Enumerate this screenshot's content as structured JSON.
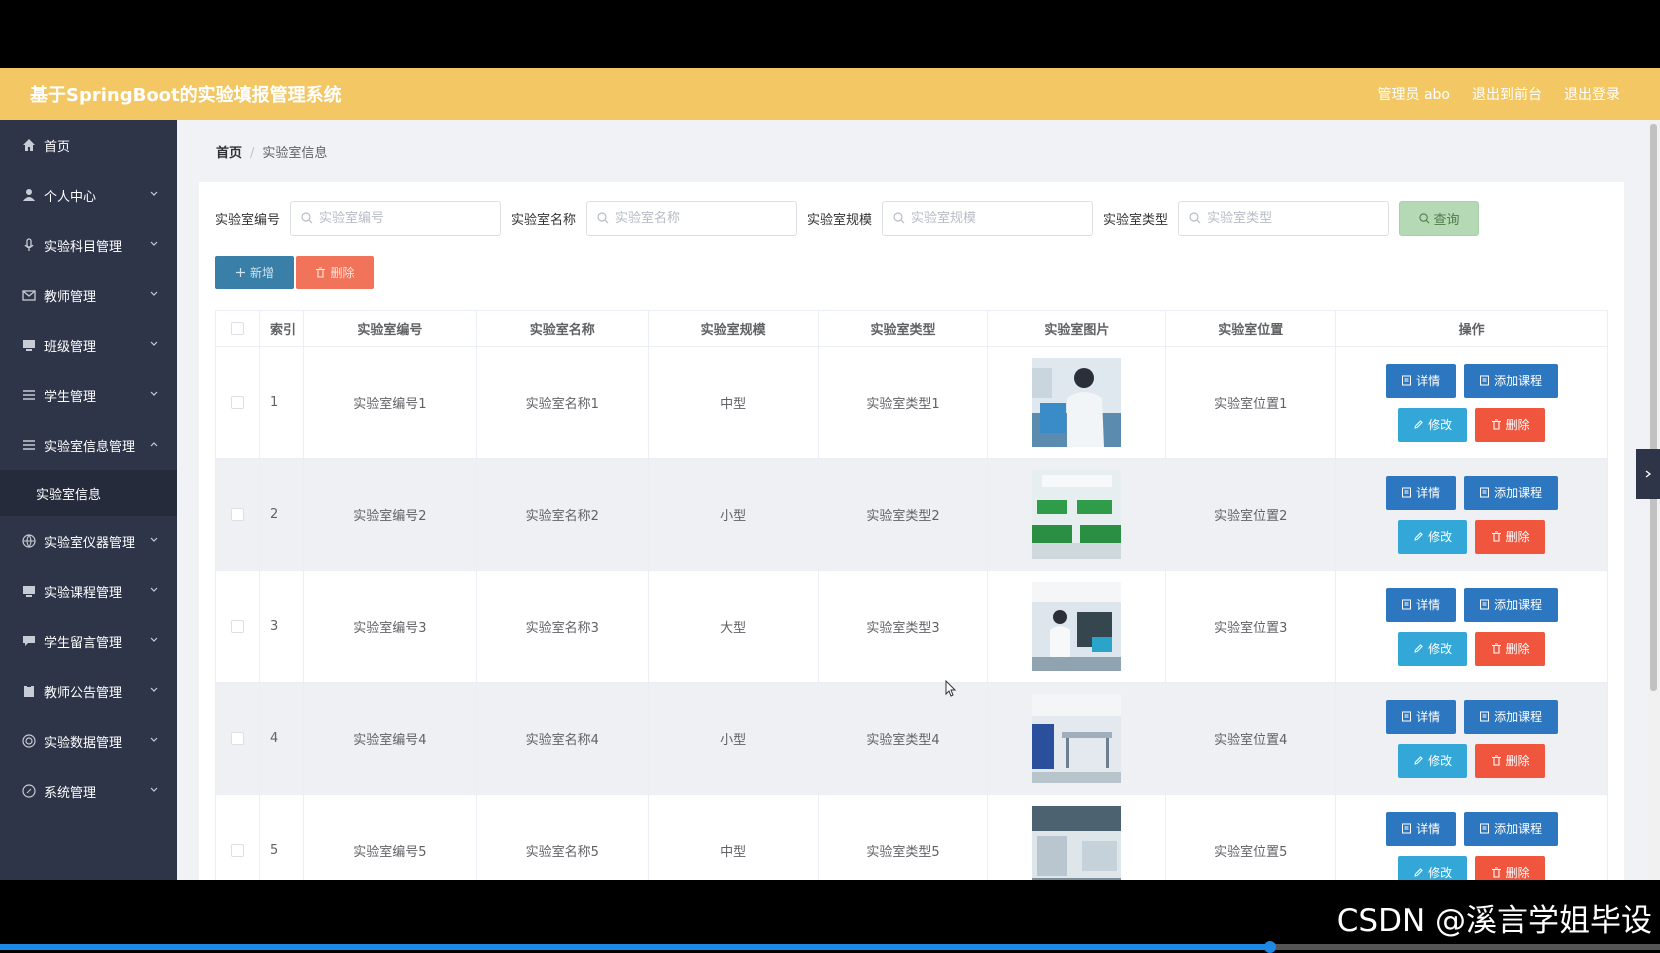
{
  "header": {
    "title": "基于SpringBoot的实验填报管理系统",
    "user": "管理员 abo",
    "to_front": "退出到前台",
    "logout": "退出登录"
  },
  "sidebar": {
    "items": [
      {
        "label": "首页",
        "icon": "home-icon"
      },
      {
        "label": "个人中心",
        "icon": "user-icon"
      },
      {
        "label": "实验科目管理",
        "icon": "mic-icon"
      },
      {
        "label": "教师管理",
        "icon": "mail-icon"
      },
      {
        "label": "班级管理",
        "icon": "monitor-icon"
      },
      {
        "label": "学生管理",
        "icon": "list-icon"
      },
      {
        "label": "实验室信息管理",
        "icon": "list-icon"
      },
      {
        "label": "实验室仪器管理",
        "icon": "globe-icon"
      },
      {
        "label": "实验课程管理",
        "icon": "monitor-icon"
      },
      {
        "label": "学生留言管理",
        "icon": "chat-icon"
      },
      {
        "label": "教师公告管理",
        "icon": "clipboard-icon"
      },
      {
        "label": "实验数据管理",
        "icon": "target-icon"
      },
      {
        "label": "系统管理",
        "icon": "compass-icon"
      }
    ],
    "sub_item": "实验室信息"
  },
  "breadcrumb": {
    "home": "首页",
    "sep": "/",
    "current": "实验室信息"
  },
  "search": {
    "fields": [
      {
        "label": "实验室编号",
        "placeholder": "实验室编号"
      },
      {
        "label": "实验室名称",
        "placeholder": "实验室名称"
      },
      {
        "label": "实验室规模",
        "placeholder": "实验室规模"
      },
      {
        "label": "实验室类型",
        "placeholder": "实验室类型"
      }
    ],
    "query_label": "查询"
  },
  "actions": {
    "add_label": "新增",
    "delete_label": "删除"
  },
  "table": {
    "columns": [
      "索引",
      "实验室编号",
      "实验室名称",
      "实验室规模",
      "实验室类型",
      "实验室图片",
      "实验室位置",
      "操作"
    ],
    "rows": [
      {
        "index": "1",
        "no": "实验室编号1",
        "name": "实验室名称1",
        "scale": "中型",
        "type": "实验室类型1",
        "location": "实验室位置1"
      },
      {
        "index": "2",
        "no": "实验室编号2",
        "name": "实验室名称2",
        "scale": "小型",
        "type": "实验室类型2",
        "location": "实验室位置2"
      },
      {
        "index": "3",
        "no": "实验室编号3",
        "name": "实验室名称3",
        "scale": "大型",
        "type": "实验室类型3",
        "location": "实验室位置3"
      },
      {
        "index": "4",
        "no": "实验室编号4",
        "name": "实验室名称4",
        "scale": "小型",
        "type": "实验室类型4",
        "location": "实验室位置4"
      },
      {
        "index": "5",
        "no": "实验室编号5",
        "name": "实验室名称5",
        "scale": "中型",
        "type": "实验室类型5",
        "location": "实验室位置5"
      }
    ],
    "row_actions": {
      "detail": "详情",
      "add_course": "添加课程",
      "edit": "修改",
      "delete": "删除"
    }
  },
  "watermark": "CSDN @溪言学姐毕设",
  "video_progress": 0.765,
  "colors": {
    "header": "#f3c864",
    "sidebar": "#2e3548",
    "primary": "#2d77c0",
    "danger": "#f0563d",
    "info": "#33a8d8"
  }
}
